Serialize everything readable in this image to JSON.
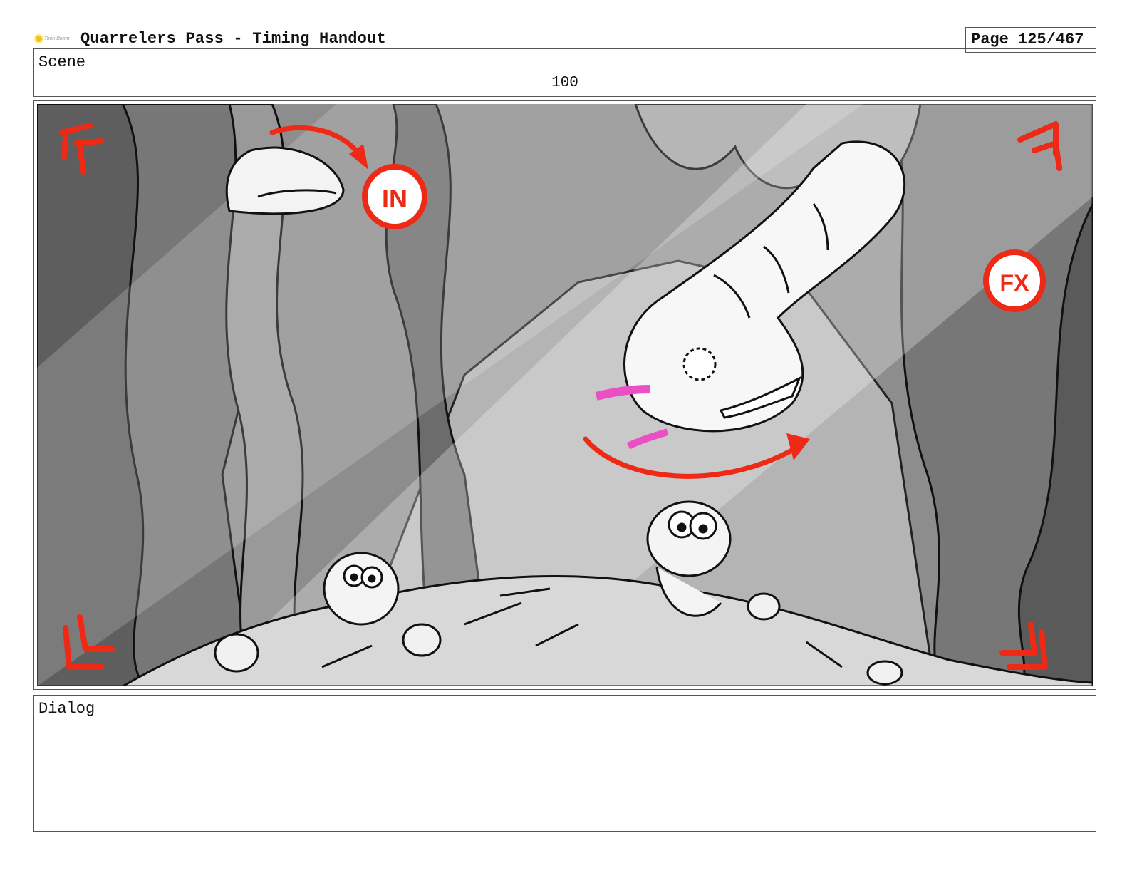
{
  "header": {
    "logo_text": "Toon Boom",
    "title": "Quarrelers Pass - Timing Handout",
    "page": "Page 125/467"
  },
  "scene": {
    "label": "Scene",
    "number": "100"
  },
  "panel": {
    "marks": {
      "in": "IN",
      "fx": "FX"
    }
  },
  "dialog": {
    "label": "Dialog",
    "text": ""
  },
  "colors": {
    "annotation_red": "#ee2a16",
    "tongue_pink": "#ea4fc4",
    "cave_dark": "#6f6f6f",
    "cave_mid": "#9a9a9a",
    "cave_light": "#c4c4c4"
  }
}
